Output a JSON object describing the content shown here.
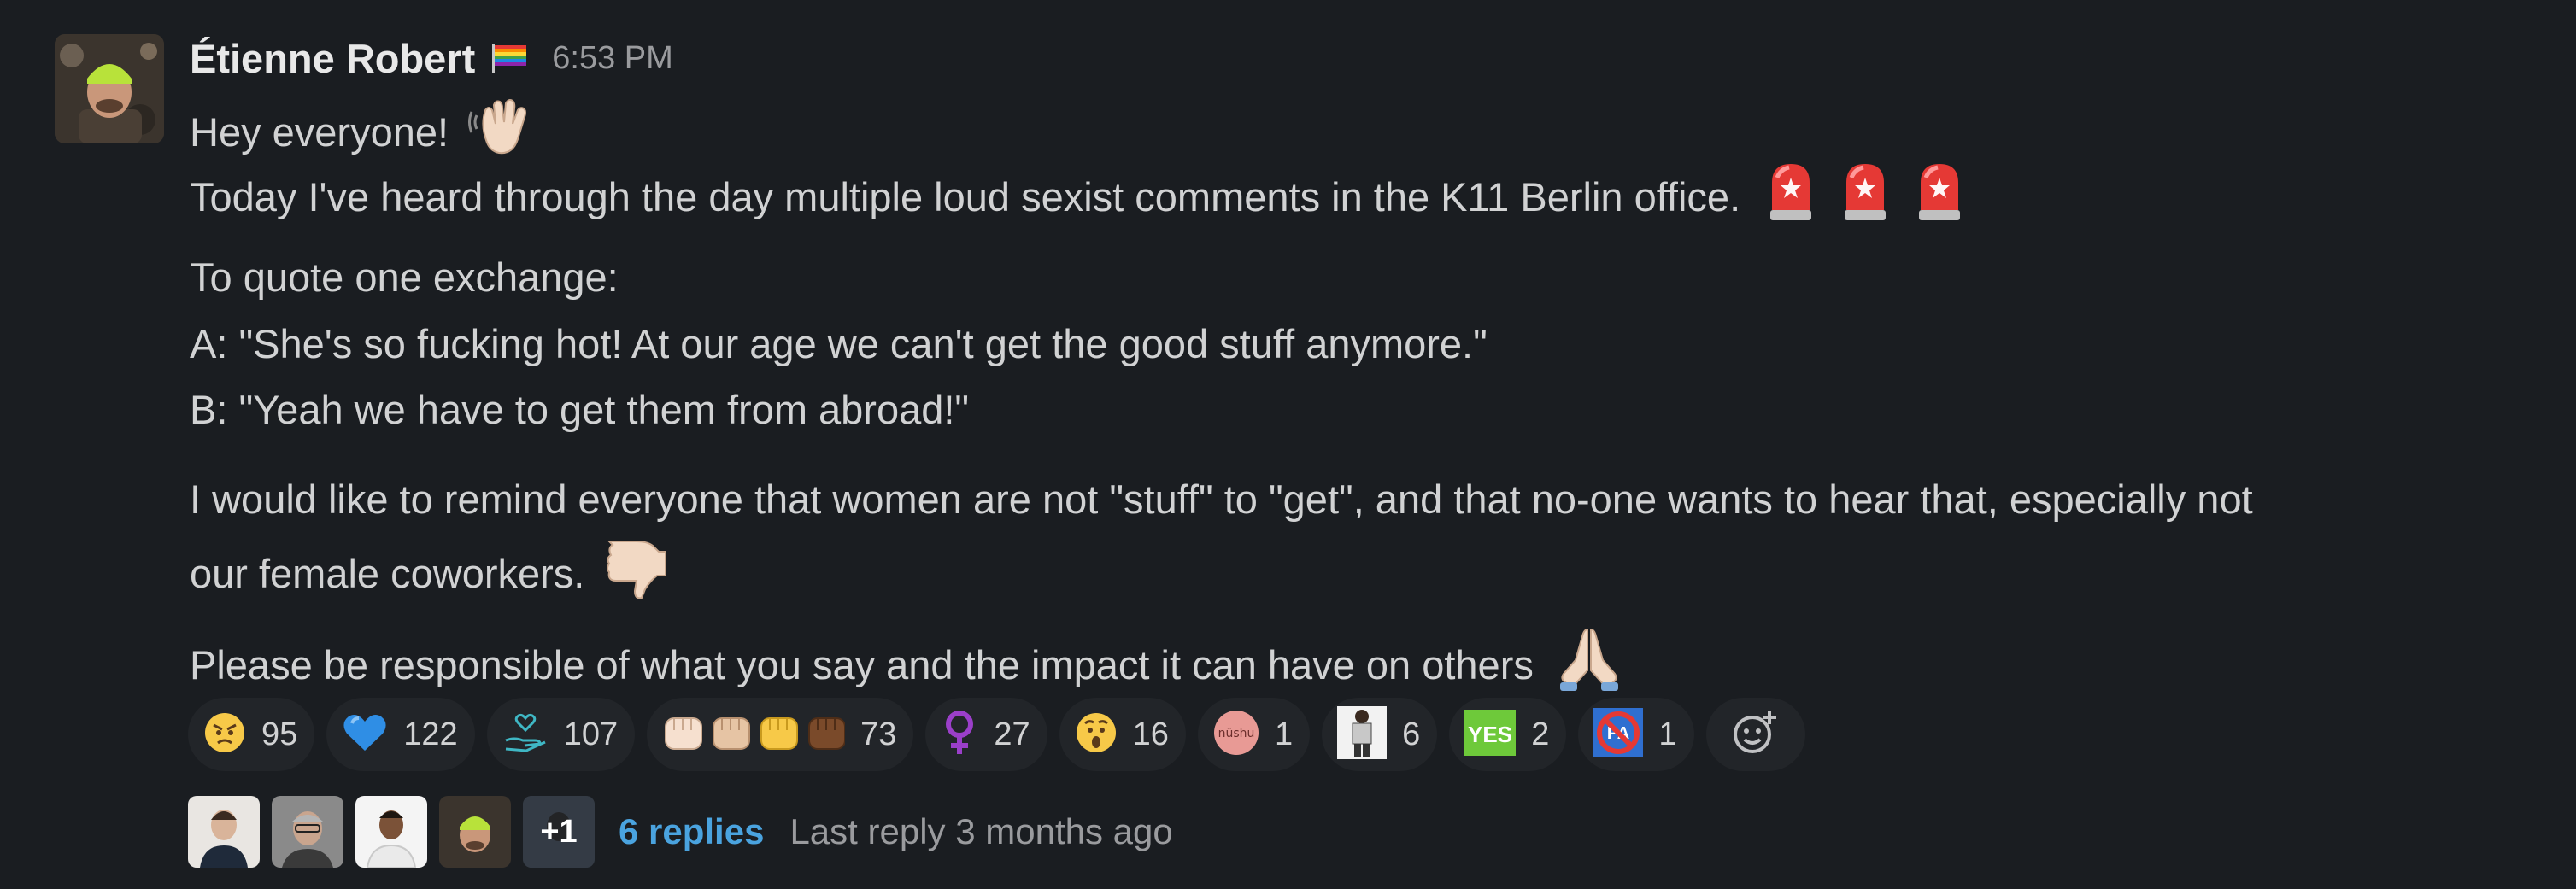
{
  "message": {
    "author": "Étienne Robert",
    "status_emoji": "rainbow-flag-icon",
    "timestamp": "6:53 PM",
    "lines": [
      "Hey everyone!",
      "Today I've heard through the day multiple loud sexist comments in the K11 Berlin office.",
      "To quote one exchange:",
      "A: \"She's so fucking hot! At our age we can't get the good stuff anymore.\"",
      "B: \"Yeah we have to get them from abroad!\"",
      "I would like to remind everyone that women are not \"stuff\" to \"get\", and that no-one wants to hear that, especially not",
      "our female coworkers.",
      "Please be responsible of what you say and the impact it can have on others"
    ]
  },
  "reactions": [
    {
      "icon": "angry-face-icon",
      "count": "95"
    },
    {
      "icon": "blue-heart-icon",
      "count": "122"
    },
    {
      "icon": "heart-hands-icon",
      "count": "107"
    },
    {
      "icon": "raised-fists-icon",
      "count": "73"
    },
    {
      "icon": "female-sign-icon",
      "count": "27"
    },
    {
      "icon": "astonished-face-icon",
      "count": "16"
    },
    {
      "icon": "nushu-badge-icon",
      "label": "nüshu",
      "count": "1"
    },
    {
      "icon": "person-figure-icon",
      "count": "6"
    },
    {
      "icon": "yes-badge-icon",
      "label": "YES",
      "count": "2"
    },
    {
      "icon": "no-pa-icon",
      "label": "PA",
      "count": "1"
    }
  ],
  "add_reaction_icon": "add-reaction-icon",
  "thread": {
    "more_count": "+1",
    "replies": "6 replies",
    "last_reply": "Last reply 3 months ago"
  },
  "colors": {
    "background": "#1a1d21",
    "pill_background": "#222529",
    "link": "#4aa3df",
    "text": "#d1d2d3",
    "muted": "#9a9b9e"
  }
}
